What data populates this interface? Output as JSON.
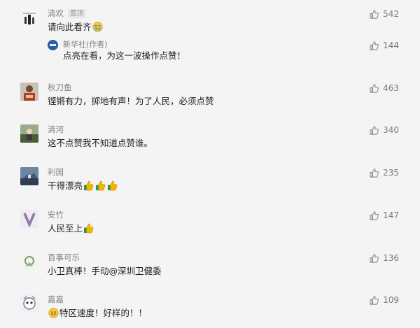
{
  "comments": [
    {
      "name": "清欢",
      "badge": "置顶",
      "text": "请向此看齐",
      "emoji": [
        "cry"
      ],
      "likes": "542",
      "reply": {
        "name": "新华社(作者)",
        "text": "点亮在看，为这一波操作点赞！",
        "likes": "144"
      }
    },
    {
      "name": "秋刀鱼",
      "text": "铿锵有力，掷地有声！为了人民，必须点赞",
      "likes": "463"
    },
    {
      "name": "清河",
      "text": "这不点赞我不知道点赞谁。",
      "likes": "340"
    },
    {
      "name": "利国",
      "text": "干得漂亮",
      "emoji": [
        "thumb",
        "thumb",
        "thumb"
      ],
      "likes": "235"
    },
    {
      "name": "安竹",
      "text": "人民至上",
      "emoji": [
        "thumb"
      ],
      "likes": "147"
    },
    {
      "name": "百事可乐",
      "text": "小卫真棒！手动@深圳卫健委",
      "likes": "136"
    },
    {
      "name": "嘉嘉",
      "text": "特区速度！好样的！！",
      "emoji_prefix": "grin",
      "likes": "109"
    }
  ],
  "colors": {
    "background": "#f4f4f4",
    "name": "#7f7f7f",
    "text": "#1f1f1f",
    "like": "#7a7a7a",
    "badge_bg": "#e6e6e6"
  }
}
